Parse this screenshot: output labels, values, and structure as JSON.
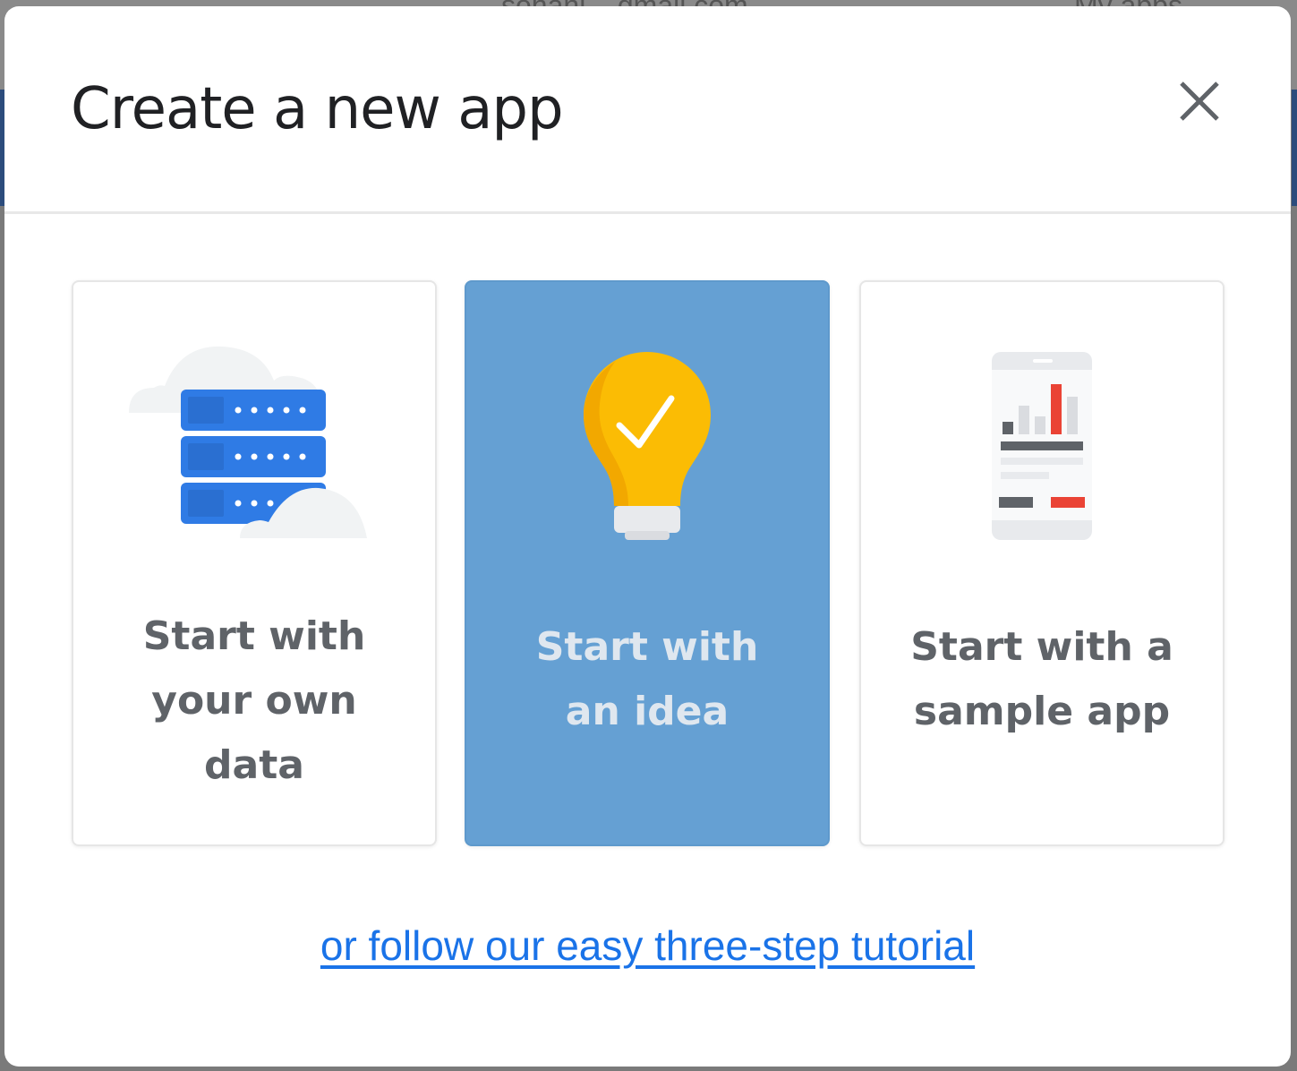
{
  "backdrop": {
    "email_text": "sohanl... gmail.com",
    "my_apps_text": "My apps"
  },
  "dialog": {
    "title": "Create a new app",
    "close_icon": "close-icon"
  },
  "cards": [
    {
      "label": "Start with\nyour own\ndata",
      "icon": "database-cloud-icon",
      "selected": false
    },
    {
      "label": "Start with\nan idea",
      "icon": "lightbulb-check-icon",
      "selected": true
    },
    {
      "label": "Start with a\nsample app",
      "icon": "phone-chart-icon",
      "selected": false
    }
  ],
  "tutorial_link": "or follow our easy three-step tutorial",
  "colors": {
    "selected_card": "#65a0d3",
    "link": "#1a73e8",
    "server_blue": "#2f7be5",
    "bulb_yellow": "#fbbc04",
    "chart_red": "#ea4335"
  }
}
